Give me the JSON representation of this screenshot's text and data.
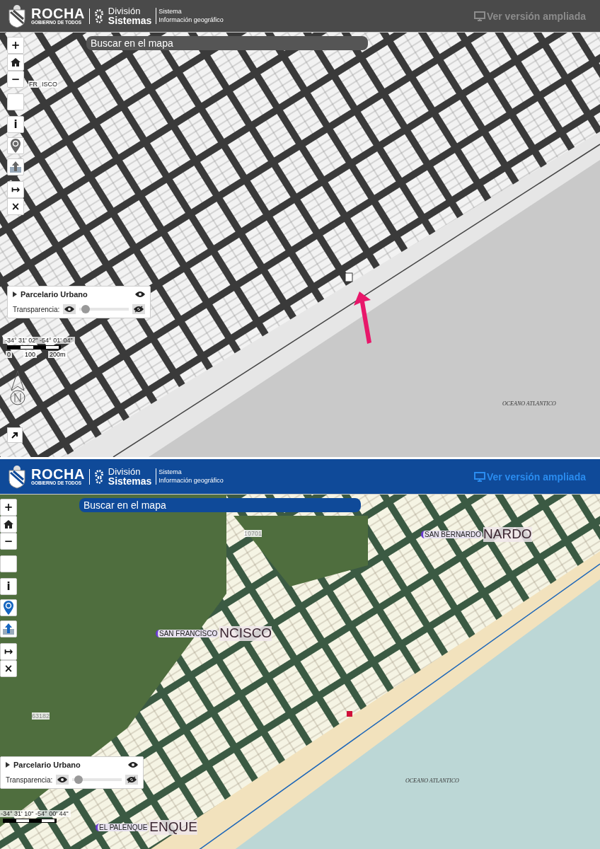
{
  "panels": [
    {
      "kind": "grayscale",
      "header": {
        "brand": "ROCHA",
        "brand_sub": "GOBIERNO DE TODOS",
        "division_1": "División",
        "division_2": "Sistemas",
        "system_1": "Sistema",
        "system_2": "Información geográfico",
        "link": "Ver versión ampliada"
      },
      "search": {
        "placeholder": "Buscar en el mapa"
      },
      "controls": [
        {
          "kind": "zoom-in",
          "label": "+"
        },
        {
          "kind": "home"
        },
        {
          "kind": "zoom-out",
          "label": "−"
        },
        {
          "kind": "blank"
        },
        {
          "kind": "info",
          "label": "i"
        },
        {
          "kind": "location"
        },
        {
          "kind": "upload"
        },
        {
          "kind": "measure",
          "label": "↦"
        },
        {
          "kind": "clear",
          "label": "×"
        }
      ],
      "layer": {
        "name": "Parcelario Urbano",
        "transparency_label": "Transparencia:",
        "level": 0.05
      },
      "scale": {
        "coords": "-34° 31' 02\" -54° 01' 04\"",
        "ticks": [
          "0",
          "100",
          "200m"
        ]
      },
      "labels": [
        {
          "kind": "place",
          "text": "FR"
        },
        {
          "kind": "place",
          "text": "ISCO"
        },
        {
          "kind": "ocean",
          "text": "OCEANO ATLANTICO"
        }
      ]
    },
    {
      "kind": "color",
      "header": {
        "brand": "ROCHA",
        "brand_sub": "GOBIERNO DE TODOS",
        "division_1": "División",
        "division_2": "Sistemas",
        "system_1": "Sistema",
        "system_2": "Información geográfico",
        "link": "Ver versión ampliada"
      },
      "search": {
        "placeholder": "Buscar en el mapa"
      },
      "controls": [
        {
          "kind": "zoom-in",
          "label": "+"
        },
        {
          "kind": "home"
        },
        {
          "kind": "zoom-out",
          "label": "−"
        },
        {
          "kind": "blank"
        },
        {
          "kind": "info",
          "label": "i"
        },
        {
          "kind": "location"
        },
        {
          "kind": "upload"
        },
        {
          "kind": "measure",
          "label": "↦"
        },
        {
          "kind": "clear",
          "label": "×"
        }
      ],
      "layer": {
        "name": "Parcelario Urbano",
        "transparency_label": "Transparencia:",
        "level": 0.05
      },
      "scale": {
        "coords": "-34° 31' 10\" -54° 00' 44\""
      },
      "labels": [
        {
          "kind": "town",
          "text": "SAN BERNARDO",
          "big": "NARDO"
        },
        {
          "kind": "town",
          "text": "SAN FRANCISCO",
          "big": "NCISCO"
        },
        {
          "kind": "parcel",
          "text": "10701"
        },
        {
          "kind": "parcel",
          "text": "63182"
        },
        {
          "kind": "ocean",
          "text": "OCEANO ATLANTICO"
        },
        {
          "kind": "town",
          "text": "EL PALENQUE",
          "big": "ENQUE"
        }
      ]
    }
  ]
}
